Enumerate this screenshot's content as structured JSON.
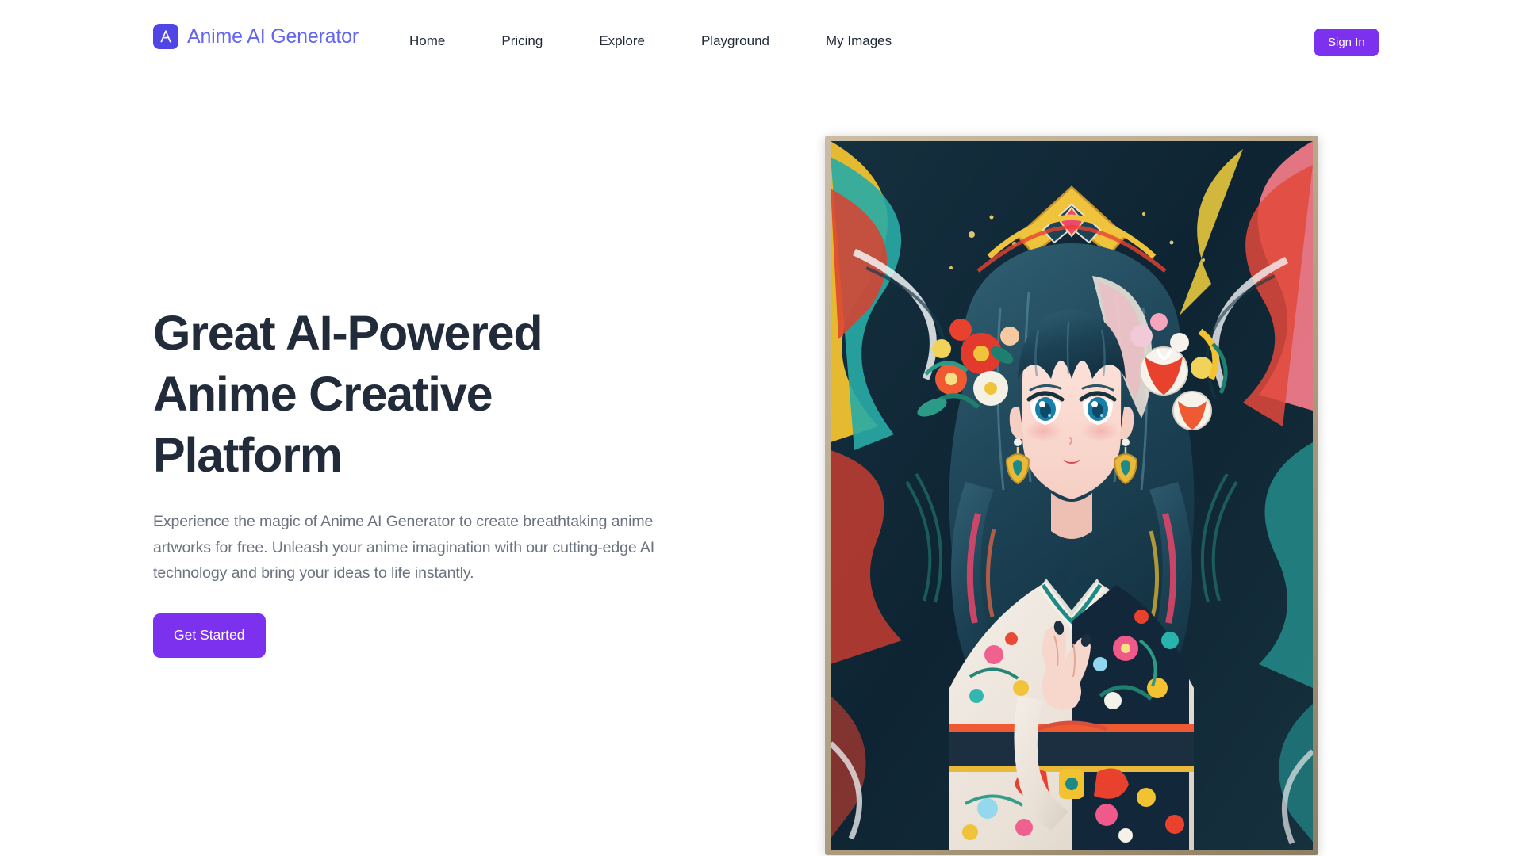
{
  "header": {
    "brand": {
      "logo_letter": "A",
      "logo_icon": "letter-a-logo-icon",
      "name": "Anime AI Generator",
      "logo_bg_color": "#4f46e5",
      "name_color": "#6366f1"
    },
    "nav": [
      {
        "label": "Home"
      },
      {
        "label": "Pricing"
      },
      {
        "label": "Explore"
      },
      {
        "label": "Playground"
      },
      {
        "label": "My Images"
      }
    ],
    "signin_label": "Sign In",
    "signin_color": "#7c31ee"
  },
  "hero": {
    "title_line1": "Great AI-Powered",
    "title_line2": "Anime Creative",
    "title_line3": "Platform",
    "title_color": "#222b3a",
    "subtitle": "Experience the magic of Anime AI Generator to create breathtaking anime artworks for free. Unleash your anime imagination with our cutting-edge AI technology and bring your ideas to life instantly.",
    "subtitle_color": "#6b7280",
    "cta_label": "Get Started",
    "cta_color": "#7c31ee",
    "artwork": {
      "name": "anime-girl-kimono-illustration",
      "description": "Framed vertical anime illustration of a girl with teal-blue hair wearing a floral kimono, surrounded by colorful abstract floral patterns",
      "frame_color": "#b9a98c"
    }
  },
  "page": {
    "background_color": "#ffffff"
  }
}
